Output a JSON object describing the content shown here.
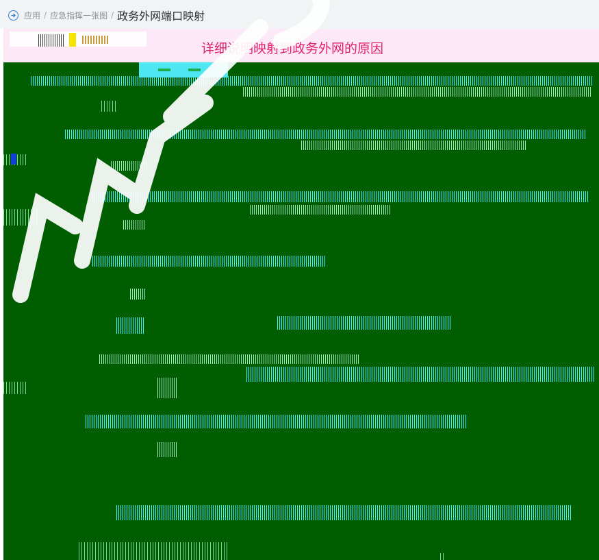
{
  "breadcrumb": {
    "items": [
      "应用",
      "应急指挥一张图"
    ],
    "separator": "/",
    "current": "政务外网端口映射"
  },
  "form": {
    "reason_note": "详细说明映射到政务外网的原因"
  },
  "colors": {
    "panel_green": "#005e00",
    "note_red": "#e0226a",
    "note_background": "#fde8f8",
    "glyph_cyan": "#48ecff",
    "nav_icon_blue": "#2b7cd3"
  },
  "icons": {
    "navigation": "arrow-circle-icon"
  }
}
